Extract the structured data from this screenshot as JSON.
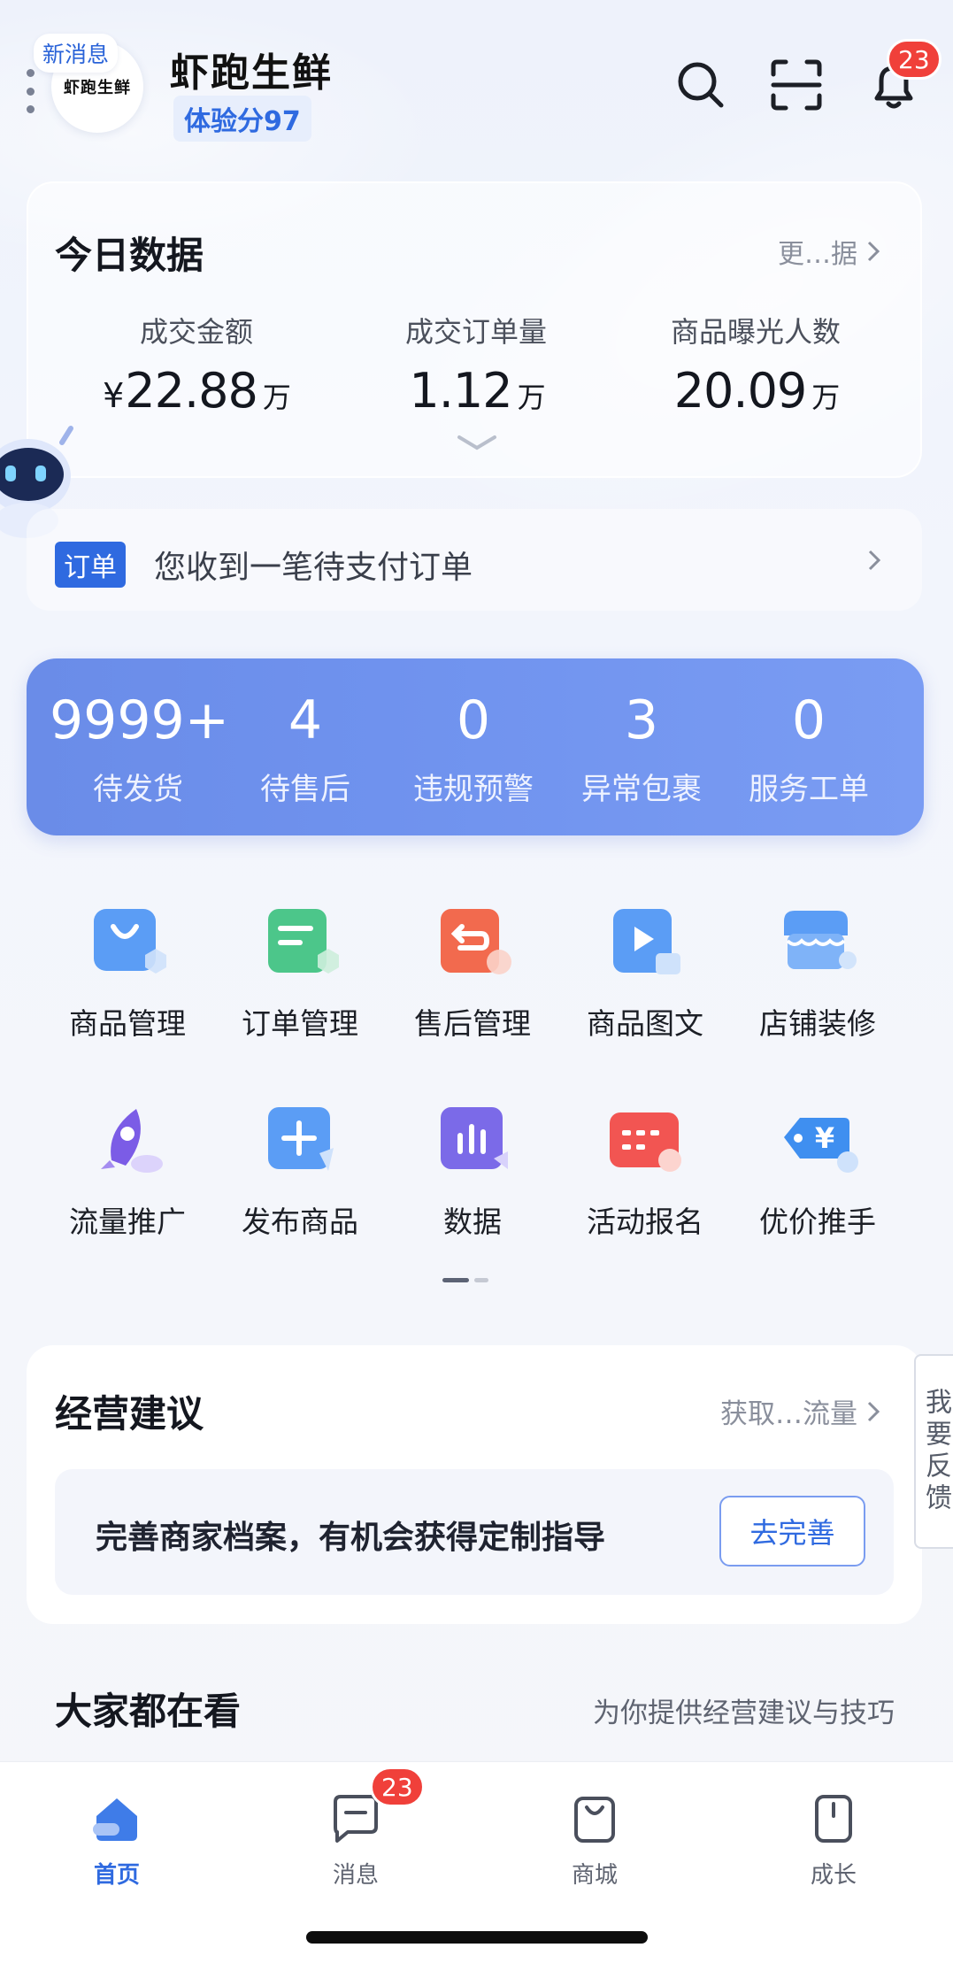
{
  "header": {
    "new_message_label": "新消息",
    "avatar_text": "虾跑生鲜",
    "store_name": "虾跑生鲜",
    "experience_score": "体验分97",
    "notification_count": "23"
  },
  "today": {
    "title": "今日数据",
    "more_label": "更…据",
    "metrics": [
      {
        "label": "成交金额",
        "currency": "¥",
        "value": "22.88",
        "unit": "万"
      },
      {
        "label": "成交订单量",
        "currency": "",
        "value": "1.12",
        "unit": "万"
      },
      {
        "label": "商品曝光人数",
        "currency": "",
        "value": "20.09",
        "unit": "万"
      }
    ]
  },
  "order_notice": {
    "tag": "订单",
    "text": "您收到一笔待支付订单"
  },
  "stats": [
    {
      "value": "9999+",
      "label": "待发货"
    },
    {
      "value": "4",
      "label": "待售后"
    },
    {
      "value": "0",
      "label": "违规预警"
    },
    {
      "value": "3",
      "label": "异常包裹"
    },
    {
      "value": "0",
      "label": "服务工单"
    }
  ],
  "grid": [
    {
      "label": "商品管理",
      "icon": "shopping-bag-icon",
      "color": "#4f8ff0"
    },
    {
      "label": "订单管理",
      "icon": "order-doc-icon",
      "color": "#3fbf7f"
    },
    {
      "label": "售后管理",
      "icon": "return-icon",
      "color": "#f0654a"
    },
    {
      "label": "商品图文",
      "icon": "video-doc-icon",
      "color": "#4f8ff0"
    },
    {
      "label": "店铺装修",
      "icon": "storefront-icon",
      "color": "#4f8ff0"
    },
    {
      "label": "流量推广",
      "icon": "rocket-icon",
      "color": "#7b5ce6"
    },
    {
      "label": "发布商品",
      "icon": "plus-icon",
      "color": "#4f8ff0"
    },
    {
      "label": "数据",
      "icon": "bar-chart-icon",
      "color": "#7b6ae8"
    },
    {
      "label": "活动报名",
      "icon": "calendar-icon",
      "color": "#f0534f"
    },
    {
      "label": "优价推手",
      "icon": "price-tag-icon",
      "color": "#3f8ff0"
    }
  ],
  "suggestion": {
    "title": "经营建议",
    "more_label": "获取…流量",
    "text": "完善商家档案，有机会获得定制指导",
    "button_label": "去完善"
  },
  "feedback_label": "我要反馈",
  "watch": {
    "title": "大家都在看",
    "subtitle": "为你提供经营建议与技巧"
  },
  "tabbar": {
    "items": [
      {
        "label": "首页",
        "icon": "home-icon",
        "active": true
      },
      {
        "label": "消息",
        "icon": "message-icon",
        "active": false
      },
      {
        "label": "商城",
        "icon": "mall-bag-icon",
        "active": false
      },
      {
        "label": "成长",
        "icon": "growth-icon",
        "active": false
      }
    ],
    "message_badge": "23"
  },
  "colors": {
    "accent": "#2f6ae0",
    "stats_bg": "#6f92ee",
    "badge": "#f0403a"
  }
}
